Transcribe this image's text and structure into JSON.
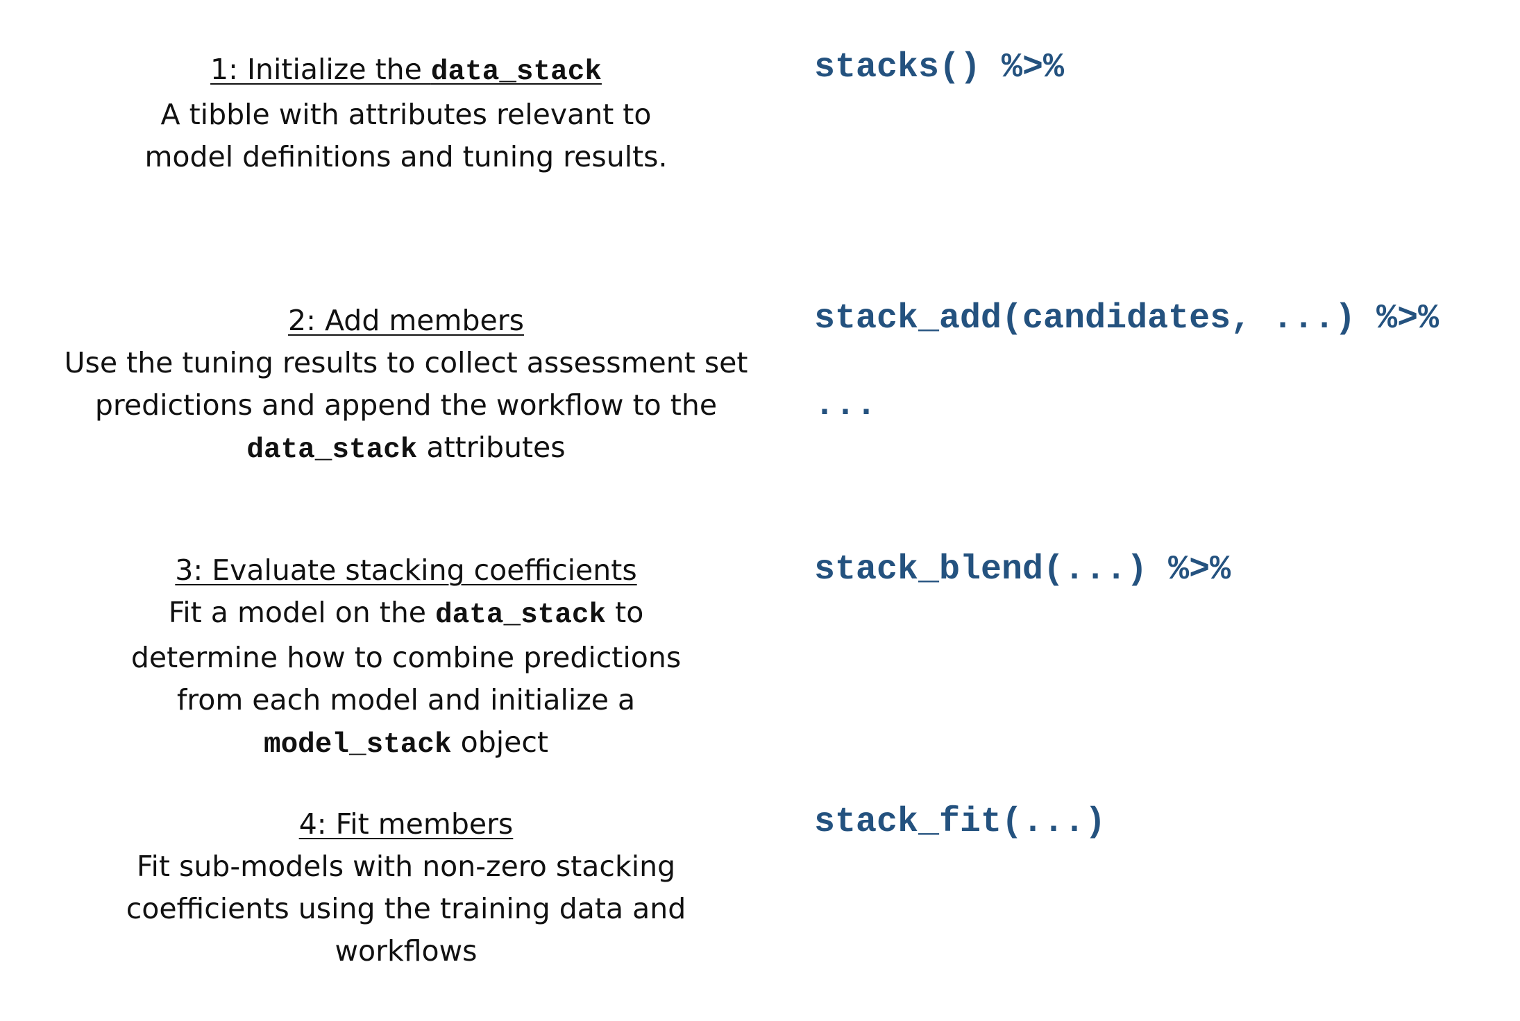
{
  "steps": [
    {
      "title_prefix": "1: Initialize the ",
      "title_code": "data_stack",
      "desc_lines": [
        "A tibble with attributes relevant to",
        "model definitions and tuning results."
      ]
    },
    {
      "title": "2: Add members",
      "desc_line1": "Use the tuning results to collect assessment set",
      "desc_line2": "predictions and append the workflow to the",
      "desc_line3_code": "data_stack",
      "desc_line3_text": " attributes"
    },
    {
      "title": "3: Evaluate stacking coefficients",
      "desc_line1_prefix": "Fit a model on the ",
      "desc_line1_code": "data_stack",
      "desc_line1_suffix": " to",
      "desc_line2": "determine how to combine predictions",
      "desc_line3": "from each model and initialize a",
      "desc_line4_code": "model_stack",
      "desc_line4_suffix": " object"
    },
    {
      "title": "4: Fit members",
      "desc_lines": [
        "Fit sub-models with non-zero stacking",
        "coefficients using the training data and",
        "workflows"
      ]
    }
  ],
  "code": {
    "line1": "stacks() %>%",
    "line2": "stack_add(candidates, ...) %>%",
    "line2_ellipsis": "...",
    "line3": "stack_blend(...) %>%",
    "line4": "stack_fit(...)"
  },
  "colors": {
    "code": "#24527f",
    "text": "#111111"
  }
}
